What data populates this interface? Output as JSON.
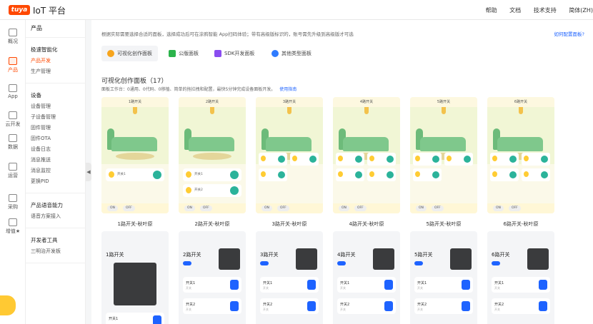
{
  "app": {
    "logo": "tuya",
    "title": "IoT 平台"
  },
  "top_links": [
    "帮助",
    "文档",
    "技术支持",
    "简体(ZH)"
  ],
  "rail": [
    {
      "label": "概况",
      "icon": "home-icon"
    },
    {
      "label": "产品",
      "icon": "product-icon",
      "active": true
    },
    {
      "label": "App",
      "icon": "phone-icon"
    },
    {
      "label": "云开发",
      "icon": "cloud-icon"
    },
    {
      "label": "数据",
      "icon": "chart-icon"
    },
    {
      "label": "运营",
      "icon": "bag-icon"
    },
    {
      "label": "采购",
      "icon": "cart-icon"
    },
    {
      "label": "增值★",
      "icon": "diamond-icon"
    }
  ],
  "subnav": {
    "header": "产品",
    "groups": [
      {
        "title": "极速智能化",
        "items": [
          "产品开发",
          "生产管理"
        ]
      },
      {
        "title": "设备",
        "items": [
          "设备管理",
          "子设备管理",
          "固件管理",
          "固件OTA",
          "设备日志",
          "消息推送",
          "消息监控",
          "更换PID"
        ]
      },
      {
        "title": "产品语音能力",
        "items": [
          "语音方案接入"
        ]
      },
      {
        "title": "开发者工具",
        "items": [
          "三明治开发板"
        ]
      }
    ],
    "active_item": "产品开发"
  },
  "main": {
    "intro": "根据实际需要选择合适的面板，选择成功后可在涂鸦智能 App扫码体验；带有高级版标识的，账号需先升级到高级版才可选",
    "how_link": "如何配置面板?",
    "tabs": [
      {
        "label": "可视化创作面板",
        "color": "#f7a51d",
        "active": true
      },
      {
        "label": "公版面板",
        "color": "#2bb34b"
      },
      {
        "label": "SDK开发面板",
        "color": "#8a4df0"
      },
      {
        "label": "其他类型面板",
        "color": "#2f7bff"
      }
    ],
    "section_title": "可视化创作面板（17）",
    "section_desc": "面板工作台：0通用、0代码、0移植、简单的拖拉拽和配置，最快5分钟完成设备面板开发。",
    "guide_link": "使用指南",
    "cards_row1": [
      {
        "label": "1路开关-秋叶原",
        "header": "1路开关",
        "switches": [
          "开关1"
        ]
      },
      {
        "label": "2路开关-秋叶原",
        "header": "2路开关",
        "switches": [
          "开关1",
          "开关2"
        ]
      },
      {
        "label": "3路开关-秋叶原",
        "header": "3路开关",
        "switches": [
          "开关1",
          "开关2",
          "开关3"
        ]
      },
      {
        "label": "4路开关-秋叶原",
        "header": "4路开关",
        "switches": [
          "开关1",
          "开关2",
          "开关3",
          "开关4"
        ]
      },
      {
        "label": "5路开关-秋叶原",
        "header": "5路开关",
        "switches": [
          "开关1",
          "开关2",
          "开关3"
        ]
      },
      {
        "label": "6路开关-秋叶原",
        "header": "6路开关",
        "switches": [
          "开关1",
          "开关2",
          "开关3",
          "开关4"
        ]
      }
    ],
    "cards_row2": [
      {
        "header": "1路开关",
        "rows": [
          "开关1"
        ]
      },
      {
        "header": "2路开关",
        "rows": [
          "开关1",
          "开关2"
        ]
      },
      {
        "header": "3路开关",
        "rows": [
          "开关1",
          "开关2"
        ]
      },
      {
        "header": "4路开关",
        "rows": [
          "开关1",
          "开关2"
        ]
      },
      {
        "header": "5路开关",
        "rows": [
          "开关1",
          "开关2"
        ]
      },
      {
        "header": "6路开关",
        "rows": [
          "开关1",
          "开关2"
        ]
      }
    ],
    "bottom_bar": {
      "on": "ON",
      "off": "OFF"
    },
    "row_sub": "开关"
  }
}
